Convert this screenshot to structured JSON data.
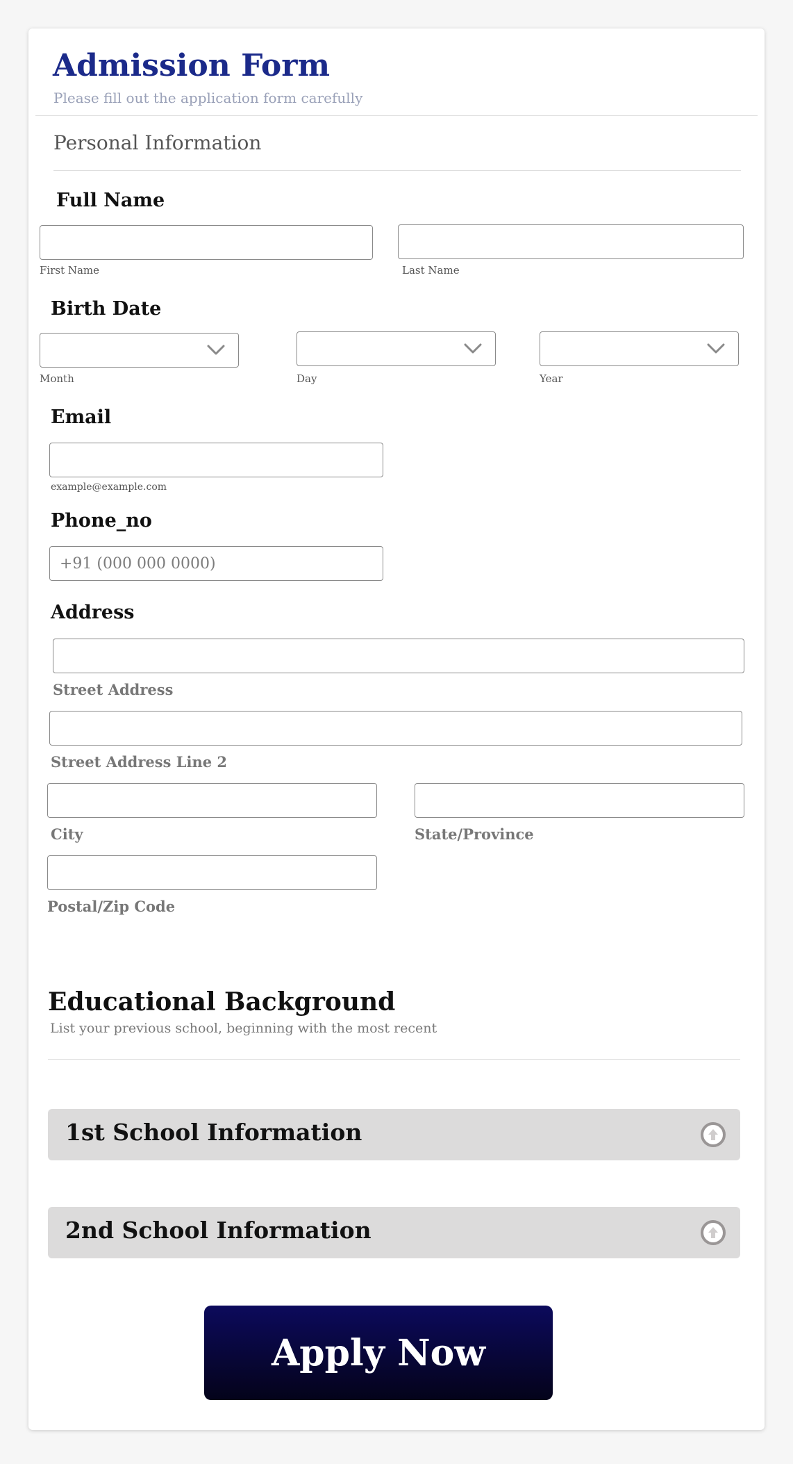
{
  "header": {
    "title": "Admission Form",
    "subtitle": "Please fill out the application form carefully"
  },
  "section_personal": "Personal Information",
  "full_name": {
    "label": "Full Name",
    "first_sublabel": "First Name",
    "last_sublabel": "Last Name"
  },
  "birth_date": {
    "label": "Birth Date",
    "month_sublabel": "Month",
    "day_sublabel": "Day",
    "year_sublabel": "Year"
  },
  "email": {
    "label": "Email",
    "hint": "example@example.com"
  },
  "phone": {
    "label": "Phone_no",
    "placeholder": "+91 (000 000 0000)"
  },
  "address": {
    "label": "Address",
    "street": "Street Address",
    "street2": "Street Address Line 2",
    "city": "City",
    "state": "State/Province",
    "postal": "Postal/Zip Code"
  },
  "education": {
    "title": "Educational Background",
    "subtitle": "List your previous school, beginning with the most recent",
    "schools": [
      {
        "label": "1st School Information"
      },
      {
        "label": "2nd School Information"
      }
    ]
  },
  "submit": {
    "label": "Apply Now"
  },
  "colors": {
    "title": "#1b2a8a",
    "school_bar": "#dcdbdb",
    "button": "#0c0a5c"
  },
  "icons": [
    "chevron-down-icon",
    "arrow-up-circle-icon"
  ]
}
